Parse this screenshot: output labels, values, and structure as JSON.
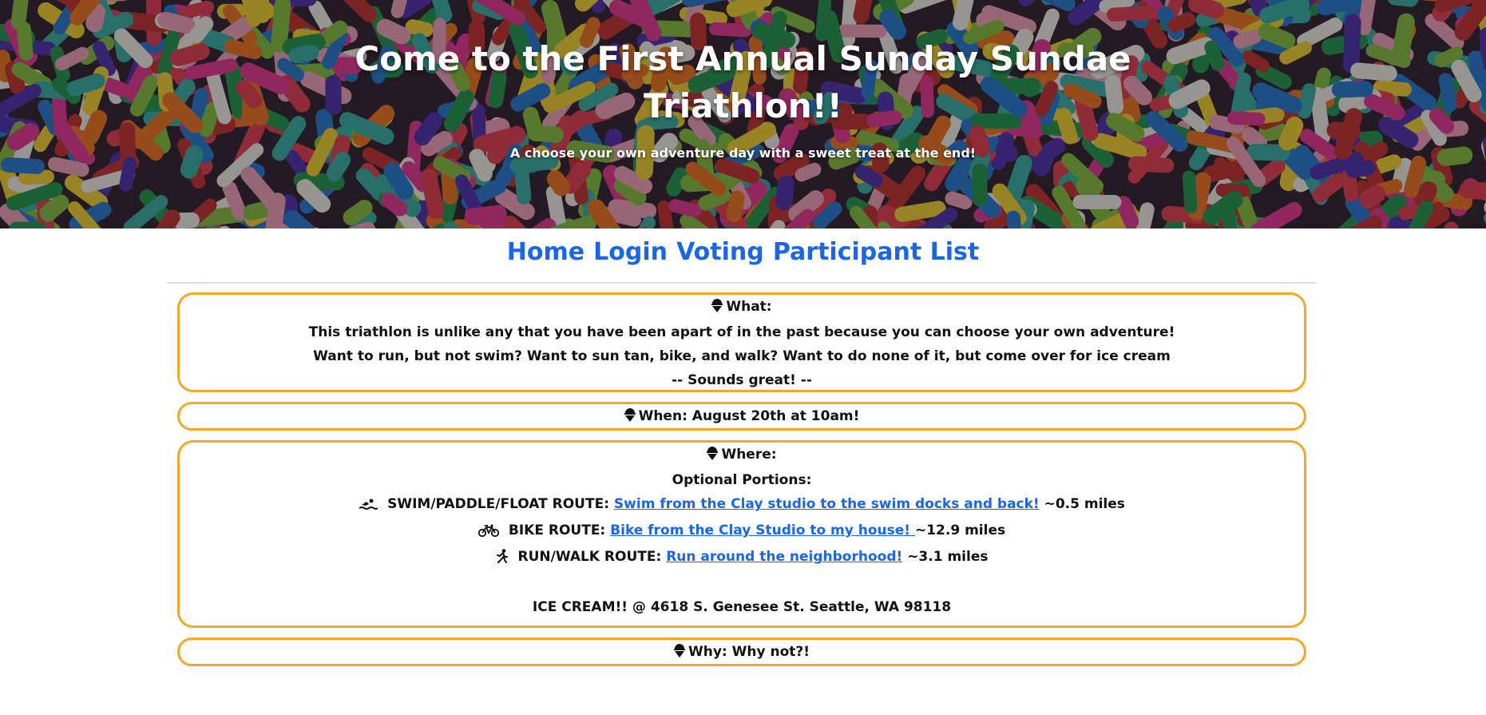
{
  "hero": {
    "title": "Come to the First Annual Sunday Sundae Triathlon!!",
    "subtitle": "A choose your own adventure day with a sweet treat at the end!"
  },
  "nav": {
    "items": [
      "Home",
      "Login",
      "Voting",
      "Participant List"
    ],
    "link_color": "#1a66e8"
  },
  "what": {
    "heading": "What:",
    "line1": "This triathlon is unlike any that you have been apart of in the past because you can choose your own adventure!",
    "line2": "Want to run, but not swim? Want to sun tan, bike, and walk? Want to do none of it, but come over for ice cream",
    "line3": "-- Sounds great! --"
  },
  "when": {
    "text": "When: August 20th at 10am!"
  },
  "where": {
    "heading": "Where:",
    "optional": "Optional Portions:",
    "routes": [
      {
        "icon": "swimmer-icon",
        "label": "SWIM/PADDLE/FLOAT ROUTE:",
        "link": "Swim from the Clay studio to the swim docks and back!",
        "distance": "~0.5 miles"
      },
      {
        "icon": "bicycle-icon",
        "label": "BIKE ROUTE:",
        "link": "Bike from the Clay Studio to my house! ",
        "distance": "~12.9 miles"
      },
      {
        "icon": "runner-icon",
        "label": "RUN/WALK ROUTE:",
        "link": "Run around the neighborhood!",
        "distance": " ~3.1 miles"
      }
    ],
    "icecream": "ICE CREAM!! @ 4618 S. Genesee St. Seattle, WA 98118"
  },
  "why": {
    "text": "Why: Why not?!"
  },
  "colors": {
    "card_border": "#f5a623",
    "link": "#1a66e8"
  },
  "icons": [
    "ice-cream-cone-icon",
    "swimmer-icon",
    "bicycle-icon",
    "runner-icon"
  ]
}
